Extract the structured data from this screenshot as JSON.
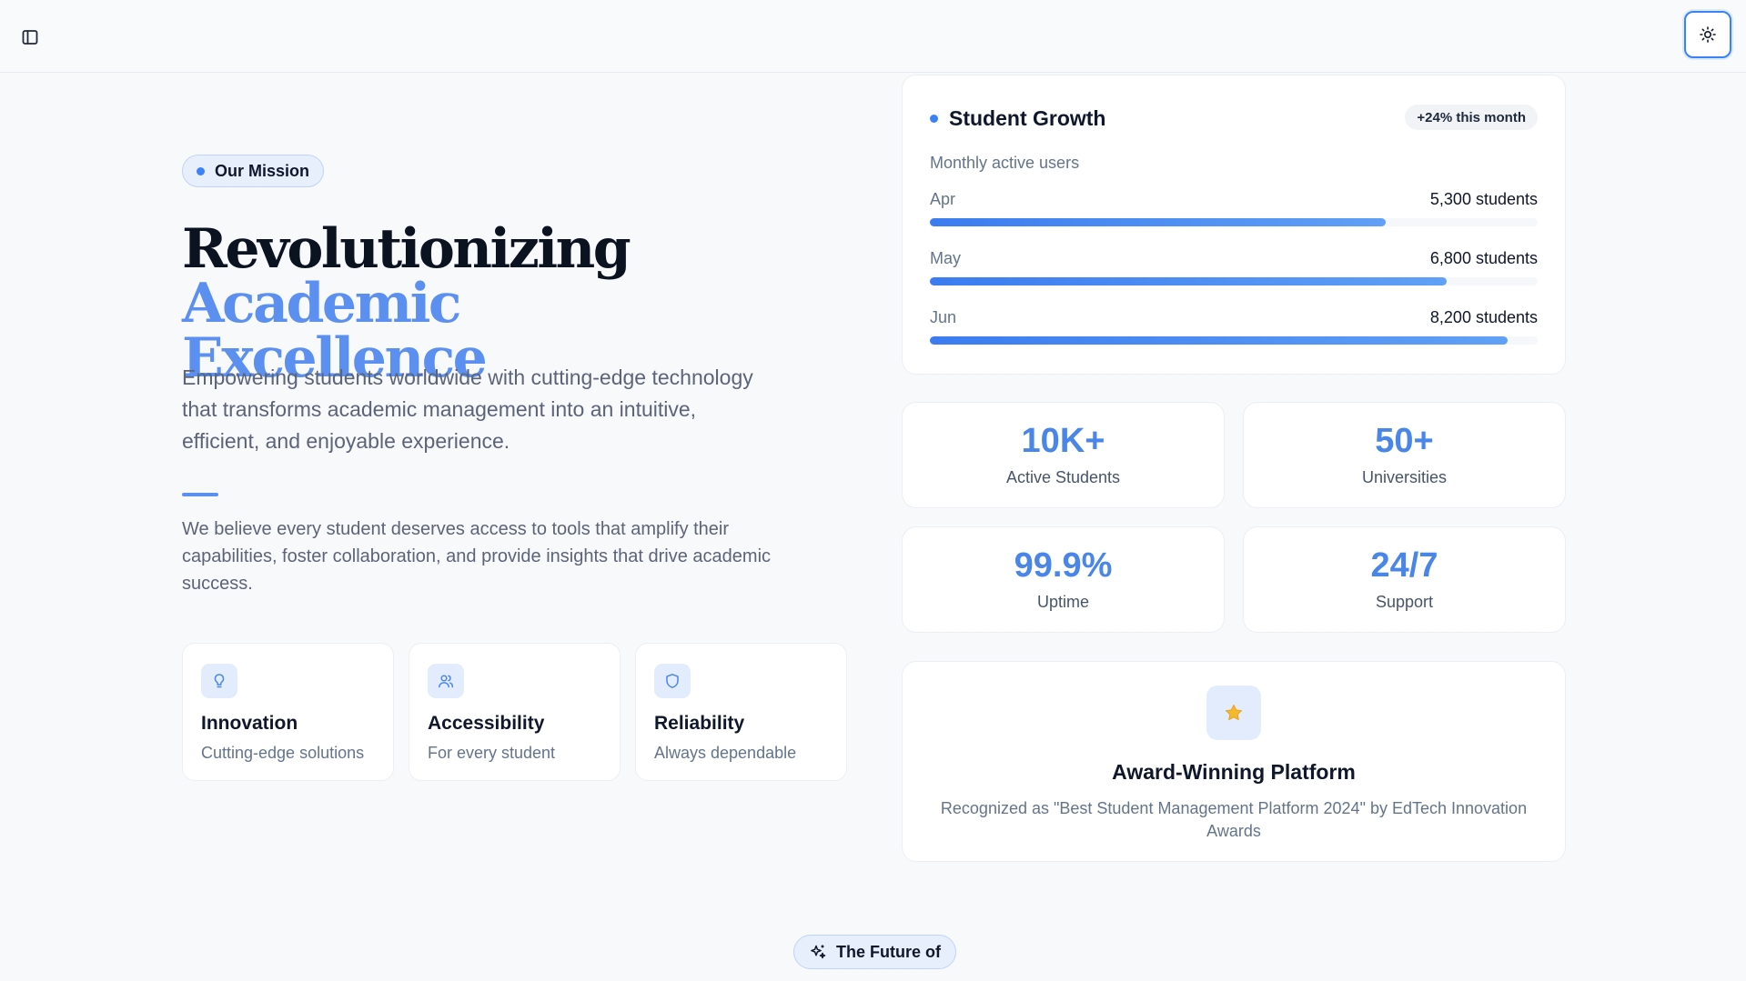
{
  "header": {
    "sidebar_toggle_icon": "panel-left-icon",
    "theme_toggle_icon": "sun-icon"
  },
  "mission": {
    "pill_label": "Our Mission",
    "headline_part1": "Revolutionizing ",
    "headline_accent1": "Academic",
    "headline_accent2": "Excellence",
    "lede": "Empowering students worldwide with cutting-edge technology that transforms academic management into an intuitive, efficient, and enjoyable experience.",
    "belief": "We believe every student deserves access to tools that amplify their capabilities, foster collaboration, and provide insights that drive academic success.",
    "features": [
      {
        "title": "Innovation",
        "subtitle": "Cutting-edge solutions",
        "icon": "lightbulb-icon"
      },
      {
        "title": "Accessibility",
        "subtitle": "For every student",
        "icon": "users-icon"
      },
      {
        "title": "Reliability",
        "subtitle": "Always dependable",
        "icon": "shield-icon"
      }
    ]
  },
  "growth": {
    "title": "Student Growth",
    "badge": "+24% this month",
    "subtitle": "Monthly active users",
    "rows": [
      {
        "month": "Apr",
        "value": "5,300 students",
        "fill_fraction": 0.75
      },
      {
        "month": "May",
        "value": "6,800 students",
        "fill_fraction": 0.85
      },
      {
        "month": "Jun",
        "value": "8,200 students",
        "fill_fraction": 0.95
      }
    ]
  },
  "stats": [
    {
      "value": "10K+",
      "label": "Active Students"
    },
    {
      "value": "50+",
      "label": "Universities"
    },
    {
      "value": "99.9%",
      "label": "Uptime"
    },
    {
      "value": "24/7",
      "label": "Support"
    }
  ],
  "award": {
    "icon": "star-icon",
    "title": "Award-Winning Platform",
    "description": "Recognized as \"Best Student Management Platform 2024\" by EdTech Innovation Awards"
  },
  "future": {
    "icon": "sparkles-icon",
    "label": "The Future of"
  },
  "colors": {
    "accent": "#4a86e8",
    "accent_light": "#5b8ff0",
    "icon_bg": "#e3ecfc",
    "star": "#f5b82e"
  }
}
